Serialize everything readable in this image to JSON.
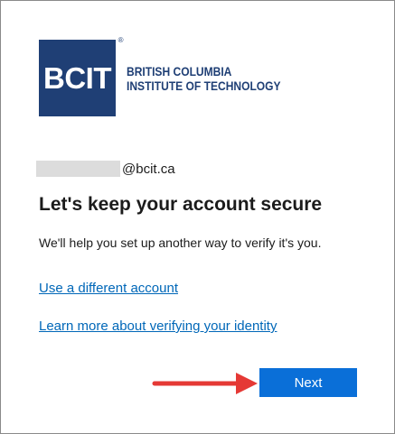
{
  "logo": {
    "mark": "BCIT",
    "registered": "®",
    "line1": "BRITISH COLUMBIA",
    "line2": "INSTITUTE OF TECHNOLOGY"
  },
  "account": {
    "domain": "@bcit.ca"
  },
  "heading": "Let's keep your account secure",
  "description": "We'll help you set up another way to verify it's you.",
  "links": {
    "different_account": "Use a different account",
    "learn_more": "Learn more about verifying your identity"
  },
  "buttons": {
    "next": "Next"
  },
  "colors": {
    "brand": "#1f3f75",
    "link": "#0067b8",
    "primary_button": "#0a6fd8",
    "annotation_arrow": "#e53935"
  }
}
